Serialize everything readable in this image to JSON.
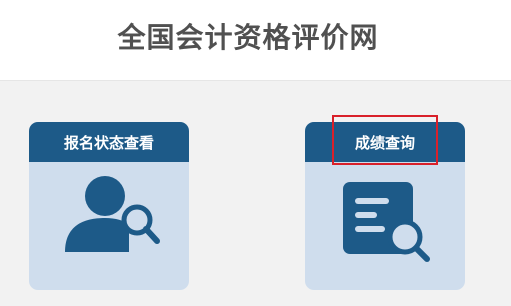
{
  "header": {
    "title": "全国会计资格评价网"
  },
  "cards": [
    {
      "label": "报名状态查看",
      "icon": "user-search-icon"
    },
    {
      "label": "成绩查询",
      "icon": "document-search-icon"
    }
  ],
  "colors": {
    "header_bg": "#1d5a88",
    "card_bg": "#cfdded",
    "icon": "#1d5a88",
    "highlight": "#d9202a",
    "title_text": "#505050"
  }
}
